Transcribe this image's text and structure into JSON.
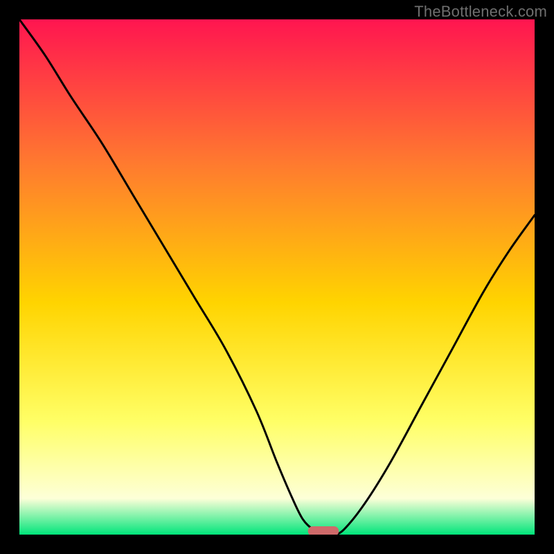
{
  "watermark": "TheBottleneck.com",
  "colors": {
    "gradient_top": "#ff1550",
    "gradient_mid1": "#ff7a2f",
    "gradient_mid2": "#ffd400",
    "gradient_mid3": "#ffff66",
    "gradient_pale": "#fdffd8",
    "gradient_bottom": "#00e57a",
    "curve": "#000000",
    "marker": "#cf6a6a",
    "frame": "#000000"
  },
  "chart_data": {
    "type": "line",
    "title": "",
    "xlabel": "",
    "ylabel": "",
    "xlim": [
      0,
      100
    ],
    "ylim": [
      0,
      100
    ],
    "series": [
      {
        "name": "bottleneck-curve",
        "x": [
          0,
          5,
          10,
          16,
          22,
          28,
          34,
          40,
          46,
          50,
          53,
          55,
          57,
          59,
          61,
          63,
          67,
          72,
          78,
          84,
          90,
          95,
          100
        ],
        "y": [
          100,
          93,
          85,
          76,
          66,
          56,
          46,
          36,
          24,
          14,
          7,
          3,
          1,
          0,
          0,
          1,
          6,
          14,
          25,
          36,
          47,
          55,
          62
        ]
      }
    ],
    "marker": {
      "x_start": 56,
      "x_end": 62,
      "y": 0
    }
  }
}
